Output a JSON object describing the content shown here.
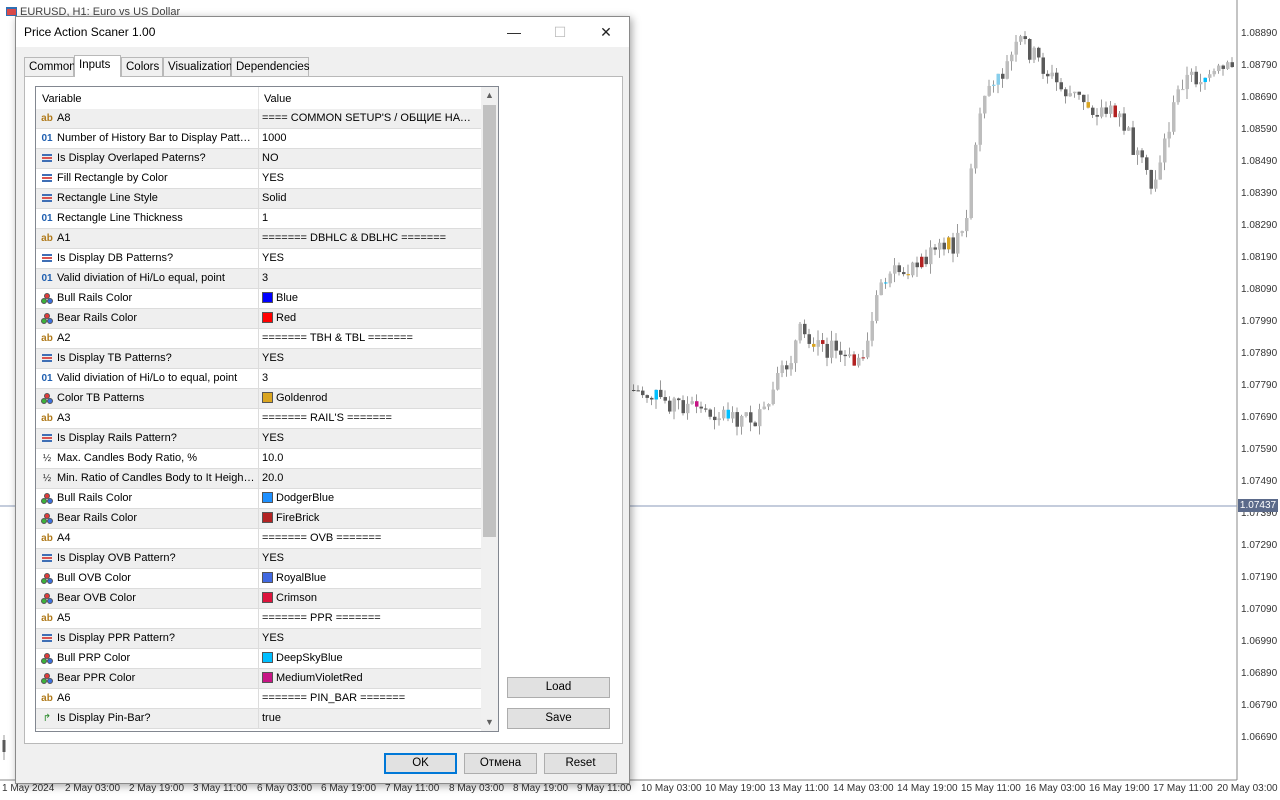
{
  "chart": {
    "title": "EURUSD, H1: Euro vs US Dollar",
    "price_labels": [
      "1.08890",
      "1.08790",
      "1.08690",
      "1.08590",
      "1.08490",
      "1.08390",
      "1.08290",
      "1.08190",
      "1.08090",
      "1.07990",
      "1.07890",
      "1.07790",
      "1.07690",
      "1.07590",
      "1.07490",
      "1.07390",
      "1.07290",
      "1.07190",
      "1.07090",
      "1.06990",
      "1.06890",
      "1.06790",
      "1.06690"
    ],
    "current_price": "1.07437",
    "time_labels": [
      "1 May 2024",
      "2 May 03:00",
      "2 May 19:00",
      "3 May 11:00",
      "6 May 03:00",
      "6 May 19:00",
      "7 May 11:00",
      "8 May 03:00",
      "8 May 19:00",
      "9 May 11:00",
      "10 May 03:00",
      "10 May 19:00",
      "13 May 11:00",
      "14 May 03:00",
      "14 May 19:00",
      "15 May 11:00",
      "16 May 03:00",
      "16 May 19:00",
      "17 May 11:00",
      "20 May 03:00"
    ]
  },
  "dialog": {
    "title": "Price Action Scaner 1.00",
    "tabs": [
      "Common",
      "Inputs",
      "Colors",
      "Visualization",
      "Dependencies"
    ],
    "active_tab": "Inputs",
    "columns": {
      "variable": "Variable",
      "value": "Value"
    },
    "rows": [
      {
        "type": "string",
        "name": "A8",
        "value": "==== COMMON SETUP'S / ОБЩИЕ НАСТРОЙКИ ===="
      },
      {
        "type": "int",
        "name": "Number of History Bar to Display Patterns",
        "value": "1000"
      },
      {
        "type": "enum",
        "name": "Is Display Overlaped Paterns?",
        "value": "NO"
      },
      {
        "type": "enum",
        "name": "Fill Rectangle by Color",
        "value": "YES"
      },
      {
        "type": "enum",
        "name": "Rectangle Line Style",
        "value": "Solid"
      },
      {
        "type": "int",
        "name": "Rectangle Line Thickness",
        "value": "1"
      },
      {
        "type": "string",
        "name": "A1",
        "value": "======= DBHLC & DBLHC ======="
      },
      {
        "type": "enum",
        "name": "Is Display DB Patterns?",
        "value": "YES"
      },
      {
        "type": "int",
        "name": "Valid diviation of Hi/Lo equal, point",
        "value": "3"
      },
      {
        "type": "color",
        "name": "Bull Rails Color",
        "value": "Blue",
        "swatch": "#0000ff"
      },
      {
        "type": "color",
        "name": "Bear Rails Color",
        "value": "Red",
        "swatch": "#ff0000"
      },
      {
        "type": "string",
        "name": "A2",
        "value": "======= TBH & TBL ======="
      },
      {
        "type": "enum",
        "name": "Is Display TB Patterns?",
        "value": "YES"
      },
      {
        "type": "int",
        "name": "Valid diviation of Hi/Lo to equal, point",
        "value": "3"
      },
      {
        "type": "color",
        "name": "Color TB Patterns",
        "value": "Goldenrod",
        "swatch": "#daa520"
      },
      {
        "type": "string",
        "name": "A3",
        "value": "======= RAIL'S ======="
      },
      {
        "type": "enum",
        "name": "Is Display Rails Pattern?",
        "value": "YES"
      },
      {
        "type": "double",
        "name": "Max. Candles Body Ratio, %",
        "value": "10.0"
      },
      {
        "type": "double",
        "name": "Min. Ratio of Candles Body to It Height, %",
        "value": "20.0"
      },
      {
        "type": "color",
        "name": "Bull Rails Color",
        "value": "DodgerBlue",
        "swatch": "#1e90ff"
      },
      {
        "type": "color",
        "name": "Bear Rails Color",
        "value": "FireBrick",
        "swatch": "#b22222"
      },
      {
        "type": "string",
        "name": "A4",
        "value": "======= OVB  ======="
      },
      {
        "type": "enum",
        "name": "Is Display OVB Pattern?",
        "value": "YES"
      },
      {
        "type": "color",
        "name": "Bull OVB Color",
        "value": "RoyalBlue",
        "swatch": "#4169e1"
      },
      {
        "type": "color",
        "name": "Bear OVB Color",
        "value": "Crimson",
        "swatch": "#dc143c"
      },
      {
        "type": "string",
        "name": "A5",
        "value": "======= PPR  ======="
      },
      {
        "type": "enum",
        "name": "Is Display PPR Pattern?",
        "value": "YES"
      },
      {
        "type": "color",
        "name": "Bull PRP Color",
        "value": "DeepSkyBlue",
        "swatch": "#00bfff"
      },
      {
        "type": "color",
        "name": "Bear PPR Color",
        "value": "MediumVioletRed",
        "swatch": "#c71585"
      },
      {
        "type": "string",
        "name": "A6",
        "value": "======= PIN_BAR  ======="
      },
      {
        "type": "bool",
        "name": "Is Display Pin-Bar?",
        "value": "true"
      }
    ],
    "buttons": {
      "load": "Load",
      "save": "Save",
      "ok": "OK",
      "cancel": "Отмена",
      "reset": "Reset"
    }
  },
  "colors": {
    "accent": "#0078d7",
    "current_price_bg": "#5b6a8a"
  }
}
